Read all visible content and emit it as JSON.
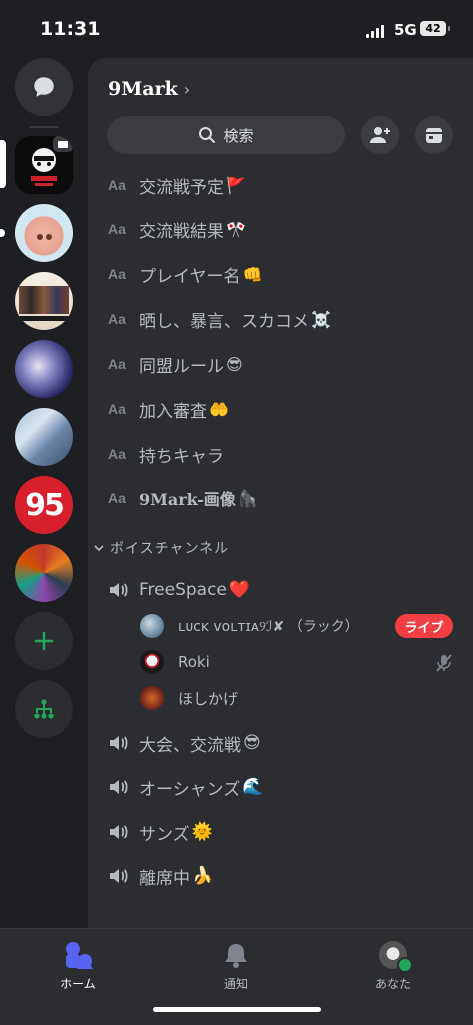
{
  "status": {
    "time": "11:31",
    "network": "5G",
    "battery": "42"
  },
  "server": {
    "name": "9Mark",
    "chevron": "›"
  },
  "header": {
    "search_label": "検索",
    "invite_icon": "add-member-icon",
    "events_icon": "calendar-icon"
  },
  "text_channels": [
    {
      "label": "交流戦予定",
      "emoji": "🚩"
    },
    {
      "label": "交流戦結果",
      "emoji": "🎌"
    },
    {
      "label": "プレイヤー名",
      "emoji": "👊"
    },
    {
      "label": "晒し、暴言、スカコメ",
      "emoji": "☠️"
    },
    {
      "label": "同盟ルール",
      "emoji": "😎"
    },
    {
      "label": "加入審査",
      "emoji": "🤲"
    },
    {
      "label": "持ちキャラ",
      "emoji": ""
    },
    {
      "label": "9Mark-画像",
      "emoji": "🦍"
    }
  ],
  "channel_prefix": "Aa",
  "voice_category": "ボイスチャンネル",
  "voice_channels": [
    {
      "label": "FreeSpace",
      "emoji": "❤️"
    },
    {
      "label": "大会、交流戦",
      "emoji": "😎"
    },
    {
      "label": "オーシャンズ",
      "emoji": "🌊"
    },
    {
      "label": "サンズ",
      "emoji": "🌞"
    },
    {
      "label": "離席中",
      "emoji": "🍌"
    }
  ],
  "voice_users": [
    {
      "name": "ʟᴜᴄᴋ ᴠᴏʟᴛɪᴀ୨ℐ✘ （ラック）",
      "badge": "ライブ"
    },
    {
      "name": "Roki",
      "badge": ""
    },
    {
      "name": "ほしかげ",
      "badge": ""
    }
  ],
  "rail": {
    "server_badges": [
      "95"
    ]
  },
  "nav": {
    "home": "ホーム",
    "notifications": "通知",
    "you": "あなた"
  },
  "colors": {
    "accent": "#5865f2",
    "live": "#f23f43",
    "online": "#23a55a",
    "add": "#23a55a"
  }
}
